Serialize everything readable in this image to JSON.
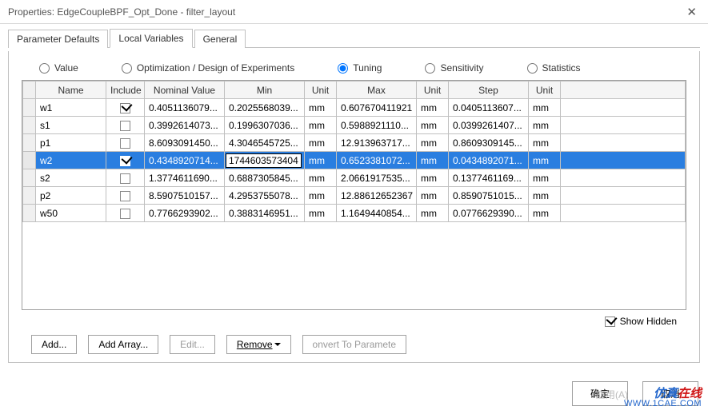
{
  "window": {
    "title": "Properties: EdgeCoupleBPF_Opt_Done - filter_layout",
    "close_glyph": "✕"
  },
  "tabs": [
    {
      "label": "Parameter Defaults",
      "active": false
    },
    {
      "label": "Local Variables",
      "active": true
    },
    {
      "label": "General",
      "active": false
    }
  ],
  "radios": {
    "value": "Value",
    "optdesign": "Optimization / Design of Experiments",
    "tuning": "Tuning",
    "sensitivity": "Sensitivity",
    "statistics": "Statistics",
    "selected": "tuning"
  },
  "columns": {
    "name": "Name",
    "include": "Include",
    "nominal": "Nominal Value",
    "min": "Min",
    "unit": "Unit",
    "max": "Max",
    "unit2": "Unit",
    "step": "Step",
    "unit3": "Unit"
  },
  "rows": [
    {
      "name": "w1",
      "include": true,
      "nominal": "0.4051136079...",
      "min": "0.2025568039...",
      "unit": "mm",
      "max": "0.607670411921",
      "unit2": "mm",
      "step": "0.0405113607...",
      "unit3": "mm"
    },
    {
      "name": "s1",
      "include": false,
      "nominal": "0.3992614073...",
      "min": "0.1996307036...",
      "unit": "mm",
      "max": "0.5988921110...",
      "unit2": "mm",
      "step": "0.0399261407...",
      "unit3": "mm"
    },
    {
      "name": "p1",
      "include": false,
      "nominal": "8.6093091450...",
      "min": "4.3046545725...",
      "unit": "mm",
      "max": "12.913963717...",
      "unit2": "mm",
      "step": "0.8609309145...",
      "unit3": "mm"
    },
    {
      "name": "w2",
      "include": true,
      "nominal": "0.4348920714...",
      "min": "1744603573404",
      "unit": "mm",
      "max": "0.6523381072...",
      "unit2": "mm",
      "step": "0.0434892071...",
      "unit3": "mm",
      "selected": true,
      "editing": "min"
    },
    {
      "name": "s2",
      "include": false,
      "nominal": "1.3774611690...",
      "min": "0.6887305845...",
      "unit": "mm",
      "max": "2.0661917535...",
      "unit2": "mm",
      "step": "0.1377461169...",
      "unit3": "mm"
    },
    {
      "name": "p2",
      "include": false,
      "nominal": "8.5907510157...",
      "min": "4.2953755078...",
      "unit": "mm",
      "max": "12.88612652367",
      "unit2": "mm",
      "step": "0.8590751015...",
      "unit3": "mm"
    },
    {
      "name": "w50",
      "include": false,
      "nominal": "0.7766293902...",
      "min": "0.3883146951...",
      "unit": "mm",
      "max": "1.1649440854...",
      "unit2": "mm",
      "step": "0.0776629390...",
      "unit3": "mm"
    }
  ],
  "show_hidden_label": "Show Hidden",
  "show_hidden_checked": true,
  "buttons": {
    "add": "Add...",
    "add_array": "Add Array...",
    "edit": "Edit...",
    "remove": "Remove",
    "convert": "onvert To Paramete"
  },
  "dialog": {
    "ok": "确定",
    "cancel": "取消",
    "apply": "应用(A)"
  },
  "watermark": {
    "line1_a": "仿真",
    "line1_b": "在线",
    "line2": "WWW.1CAE.COM"
  }
}
